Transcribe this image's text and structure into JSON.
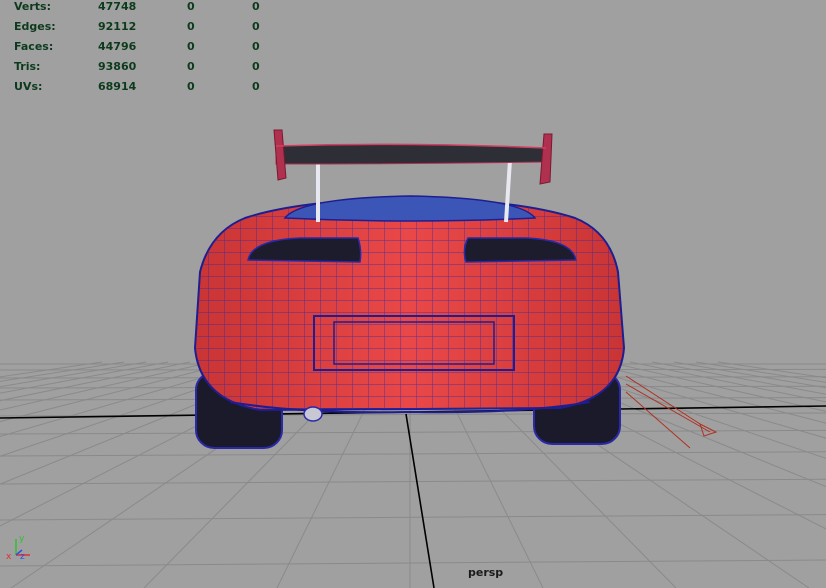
{
  "hud": {
    "stats": [
      {
        "label": "Verts:",
        "v1": "47748",
        "v2": "0",
        "v3": "0"
      },
      {
        "label": "Edges:",
        "v1": "92112",
        "v2": "0",
        "v3": "0"
      },
      {
        "label": "Faces:",
        "v1": "44796",
        "v2": "0",
        "v3": "0"
      },
      {
        "label": "Tris:",
        "v1": "93860",
        "v2": "0",
        "v3": "0"
      },
      {
        "label": "UVs:",
        "v1": "68914",
        "v2": "0",
        "v3": "0"
      }
    ]
  },
  "viewport": {
    "camera": "persp",
    "axis_labels": {
      "x": "x",
      "y": "y",
      "z": "z"
    }
  },
  "colors": {
    "background": "#a0a0a0",
    "grid": "#8a8a8a",
    "grid_axis": "#000000",
    "car_body": "#e84545",
    "wireframe": "#2a2aa8",
    "hud_text": "#0d3a1c"
  }
}
